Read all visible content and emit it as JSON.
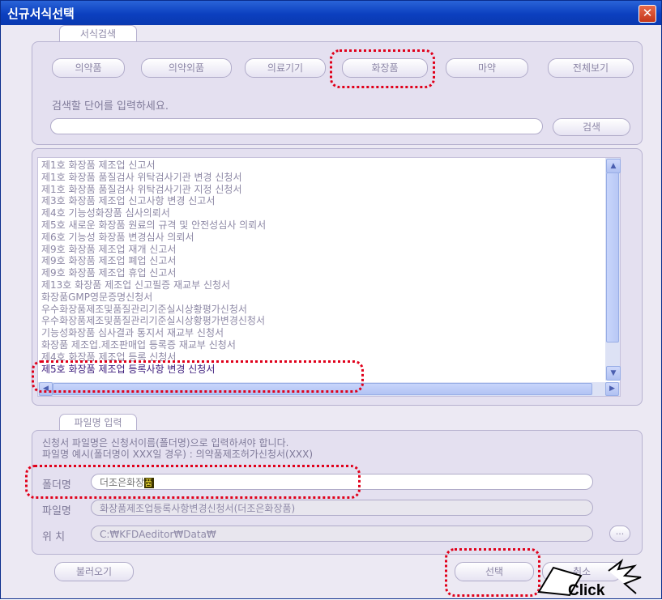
{
  "window": {
    "title": "신규서식선택",
    "close_glyph": "✕"
  },
  "search_section": {
    "tab_label": "서식검색",
    "category_buttons": [
      "의약품",
      "의약외품",
      "의료기기",
      "화장품",
      "마약",
      "전체보기"
    ],
    "prompt": "검색할 단어를 입력하세요.",
    "search_value": "",
    "search_button": "검색"
  },
  "form_list": {
    "items": [
      "제1호 화장품 제조업 신고서",
      "제1호 화장품 품질검사 위탁검사기관 변경 신청서",
      "제1호 화장품 품질검사 위탁검사기관 지정 신청서",
      "제3호 화장품 제조업 신고사항 변경 신고서",
      "제4호 기능성화장품 심사의뢰서",
      "제5호 새로운 화장품 원료의 규격 및 안전성심사 의뢰서",
      "제6호 기능성 화장품 변경심사 의뢰서",
      "제9호 화장품 제조업 재개 신고서",
      "제9호 화장품 제조업 폐업 신고서",
      "제9호 화장품 제조업 휴업 신고서",
      "제13호 화장품 제조업 신고필증 재교부 신청서",
      "화장품GMP영문증명신청서",
      "우수화장품제조및품질관리기준실시상황평가신청서",
      "우수화장품제조및품질관리기준실시상황평가변경신청서",
      "기능성화장품 심사결과 통지서 재교부 신청서",
      "화장품 제조업.제조판매업 등록증 재교부 신청서",
      "제4호 화장품 제조업 등록 신청서",
      "제5호 화장품 제조업 등록사항 변경 신청서"
    ],
    "selected_index": 17,
    "scroll_up": "▲",
    "scroll_down": "▼",
    "scroll_left": "◀",
    "scroll_right": "▶"
  },
  "filename_section": {
    "tab_label": "파일명 입력",
    "note_line1": "신청서 파일명은 신청서이름(폴더명)으로 입력하셔야 합니다.",
    "note_line2": "파일명 예시(폴더명이 XXX일 경우) : 의약품제조허가신청서(XXX)",
    "folder_label": "폴더명",
    "folder_value": "더조은화장",
    "folder_cursor_char": "품",
    "file_label": "파일명",
    "file_value": "화장품제조업등록사항변경신청서(더조은화장품)",
    "location_label": "위  치",
    "location_value": "C:₩KFDAeditor₩Data₩",
    "browse_button": "..."
  },
  "footer": {
    "load_button": "불러오기",
    "select_button": "선택",
    "cancel_button": "취소"
  },
  "annotation": {
    "click_label": "Click",
    "highlight_color": "#e0001a"
  }
}
